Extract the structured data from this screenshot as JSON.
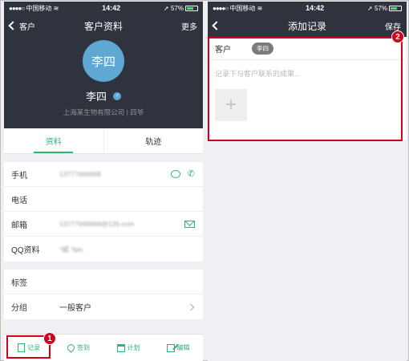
{
  "left": {
    "status": {
      "carrier": "中国移动",
      "time": "14:42",
      "battery": "57%"
    },
    "nav": {
      "back_label": "客户",
      "title": "客户资料",
      "more_label": "更多"
    },
    "profile": {
      "avatar_text": "李四",
      "name": "李四",
      "company": "上海某生物有限公司 | 四爷"
    },
    "tabs": [
      "资料",
      "轨迹"
    ],
    "fields": [
      {
        "label": "手机",
        "value": "13777666668"
      },
      {
        "label": "电话",
        "value": ""
      },
      {
        "label": "邮箱",
        "value": "13777666668@126.com"
      },
      {
        "label": "QQ资料",
        "value": "*斌.*bin."
      }
    ],
    "tags_label": "标签",
    "group": {
      "label": "分组",
      "value": "一般客户"
    },
    "bottombar": [
      "记录",
      "签到",
      "计划",
      "编辑"
    ],
    "callout": "1"
  },
  "right": {
    "status": {
      "carrier": "中国移动",
      "time": "14:42",
      "battery": "57%"
    },
    "nav": {
      "title": "添加记录",
      "save_label": "保存"
    },
    "customer_label": "客户",
    "customer_chip": "李四",
    "placeholder": "记录下与客户联系的成果...",
    "add_symbol": "+",
    "callout": "2"
  },
  "colors": {
    "accent": "#2bb673",
    "header": "#2f333d",
    "avatar": "#5fa8d3",
    "callout": "#d0021b"
  }
}
